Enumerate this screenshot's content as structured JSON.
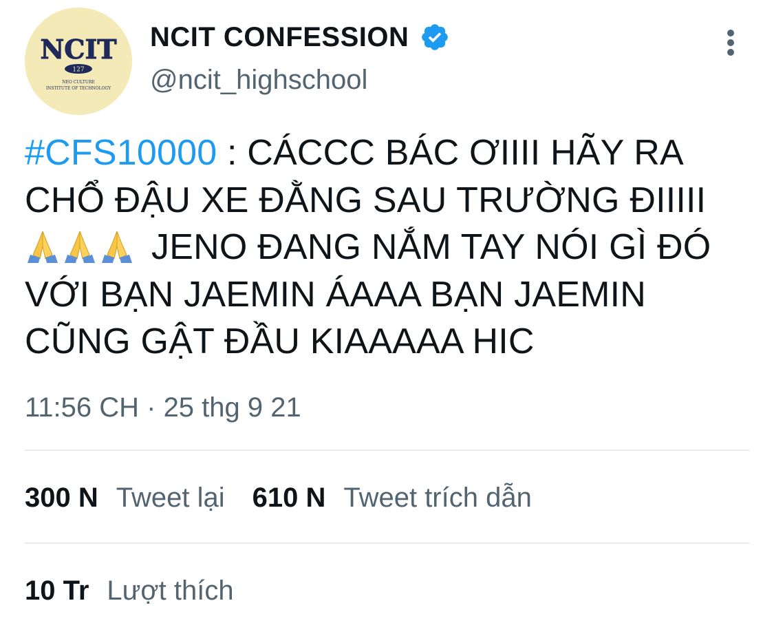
{
  "author": {
    "display_name": "NCIT CONFESSION",
    "handle": "@ncit_highschool",
    "verified": true,
    "avatar": {
      "logo_text": "NCIT",
      "badge_number": "127",
      "line1": "NEO CULTURE",
      "line2": "INSTITUTE OF TECHNOLOGY"
    }
  },
  "tweet": {
    "hashtag": "#CFS10000",
    "text_part1": " : CÁCCC BÁC ƠIIII HÃY RA CHỔ ĐẬU XE ĐẰNG SAU TRƯỜNG ĐIIIII",
    "emoji": [
      "folded-hands",
      "folded-hands",
      "folded-hands"
    ],
    "text_part2": "JENO ĐANG NẮM TAY NÓI GÌ ĐÓ VỚI BẠN JAEMIN ÁAAA BẠN JAEMIN CŨNG GẬT ĐẦU KIAAAAA HIC",
    "timestamp": "11:56 CH · 25 thg 9 21"
  },
  "stats": {
    "retweets_count": "300 N",
    "retweets_label": "Tweet lại",
    "quotes_count": "610 N",
    "quotes_label": "Tweet trích dẫn",
    "likes_count": "10 Tr",
    "likes_label": "Lượt thích"
  },
  "colors": {
    "accent": "#1d9bf0",
    "secondary_text": "#536471",
    "divider": "#e7e9ea",
    "avatar_bg": "#f3eab7",
    "logo_navy": "#1f2a5a"
  }
}
